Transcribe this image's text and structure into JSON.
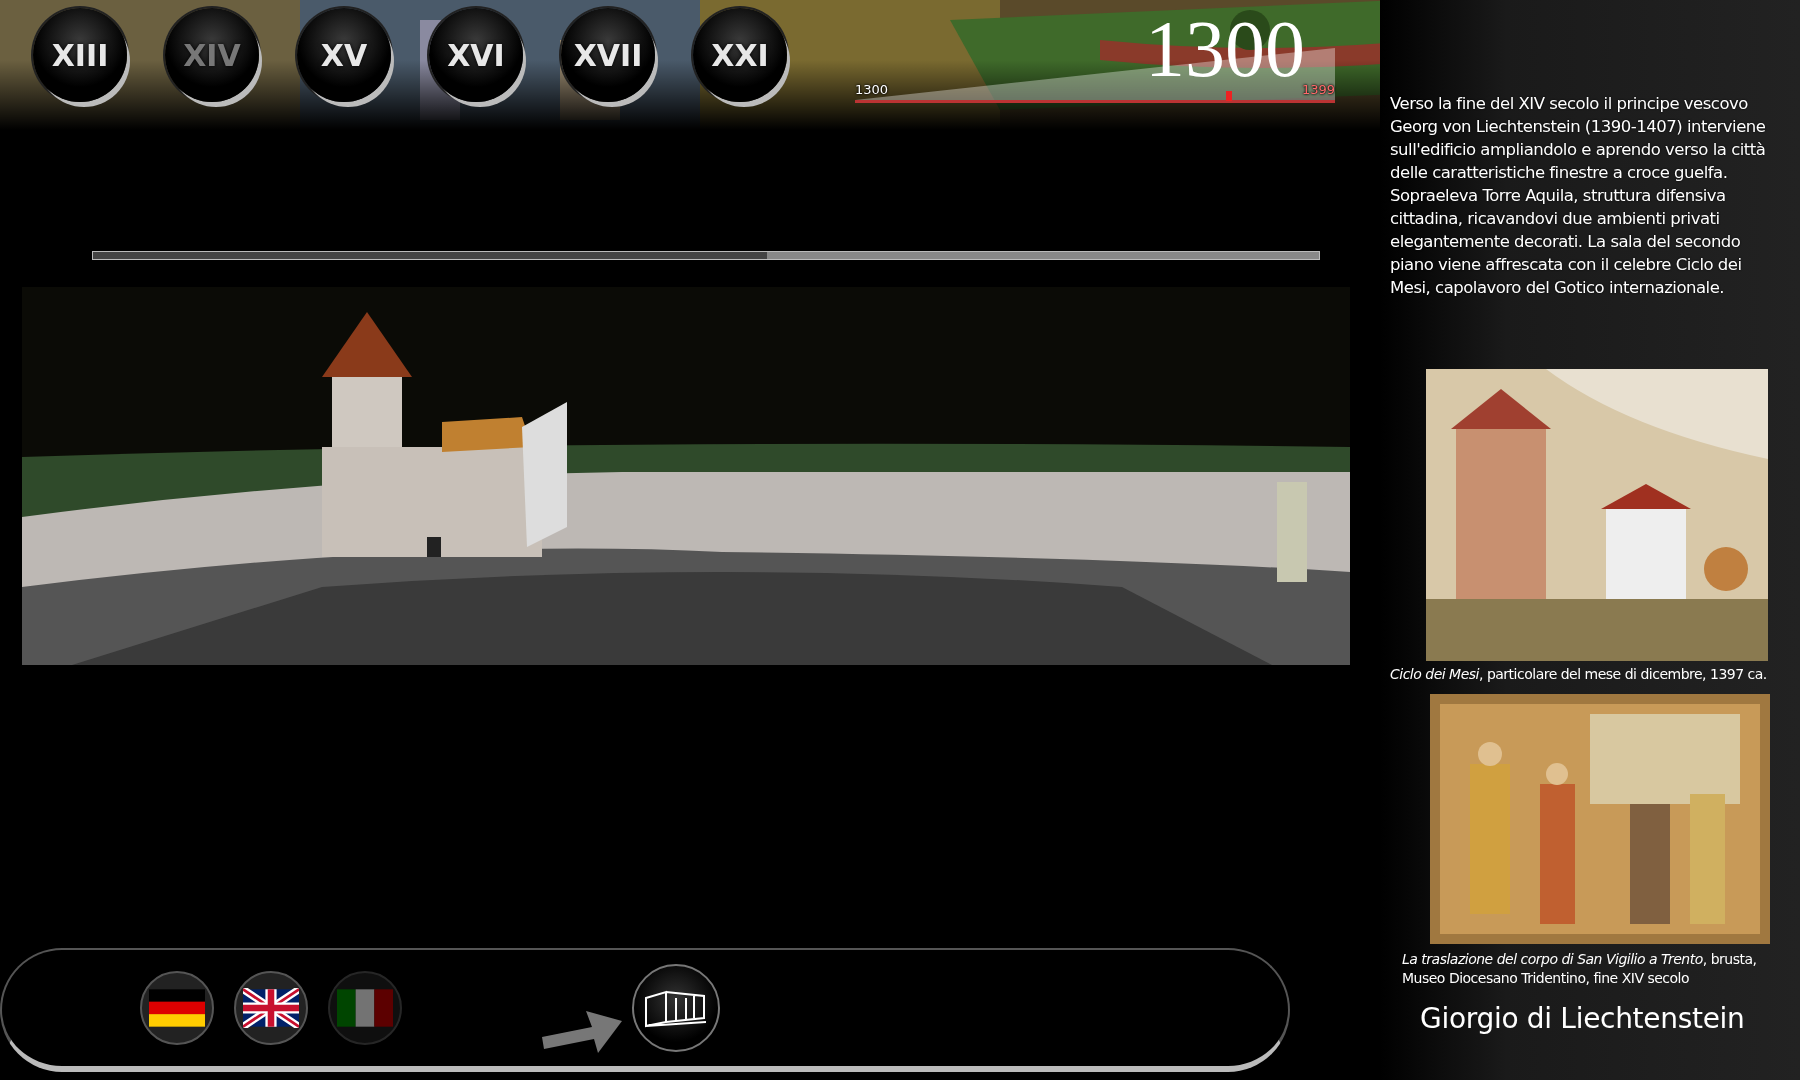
{
  "centuries": [
    {
      "label": "XIII",
      "selected": false
    },
    {
      "label": "XIV",
      "selected": true
    },
    {
      "label": "XV",
      "selected": false
    },
    {
      "label": "XVI",
      "selected": false
    },
    {
      "label": "XVII",
      "selected": false
    },
    {
      "label": "XXI",
      "selected": false
    }
  ],
  "timeline": {
    "year": "1300",
    "start": "1300",
    "end": "1399",
    "level": 0.78
  },
  "progress": {
    "level": 0.55
  },
  "view": {
    "kind": "picture"
  },
  "languages": [
    {
      "kind": "de",
      "selected": false
    },
    {
      "kind": "en",
      "selected": false
    },
    {
      "kind": "it",
      "selected": true
    }
  ],
  "description": [
    "Verso la fine del XIV secolo il principe vescovo Georg von Liechtenstein (1390-1407) interviene sull'edificio ampliandolo e aprendo verso la città delle caratteristiche finestre a croce guelfa.",
    "Sopraeleva Torre Aquila, struttura difensiva cittadina, ricavandovi due ambienti privati elegantemente decorati. La sala del secondo piano viene affrescata con il celebre Ciclo dei Mesi, capolavoro del Gotico internazionale."
  ],
  "figures": [
    {
      "caption": "*Ciclo dei Mesi*, particolare del mese di dicembre, 1397 ca."
    },
    {
      "caption": "*La traslazione del corpo di San Vigilio a Trento*, brusta, Museo Diocesano Tridentino, fine XIV secolo"
    }
  ],
  "title": "Giorgio di Liechtenstein"
}
